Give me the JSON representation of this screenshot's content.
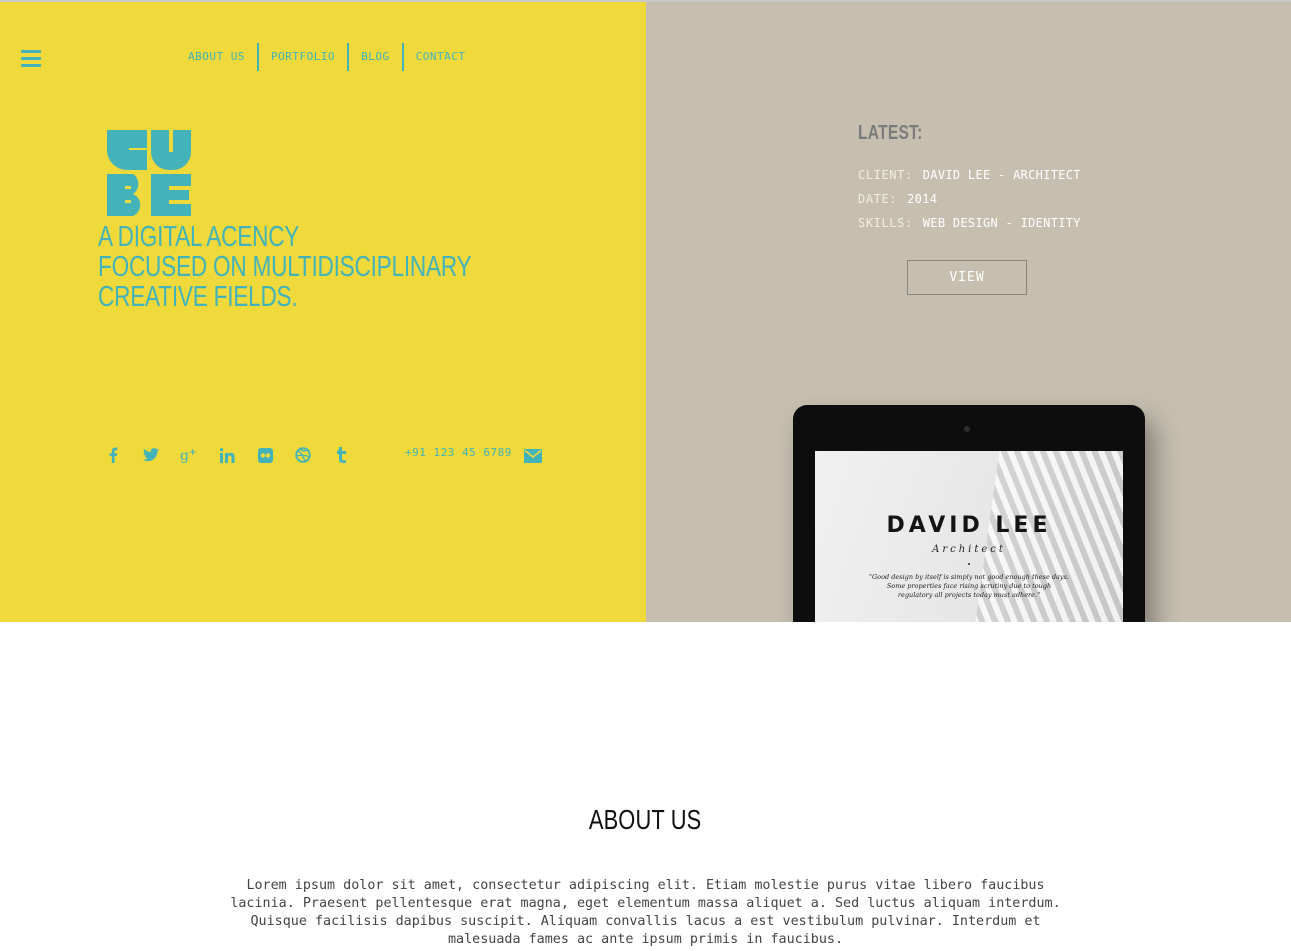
{
  "nav": {
    "items": [
      {
        "label": "ABOUT US"
      },
      {
        "label": "PORTFOLIO"
      },
      {
        "label": "BLOG"
      },
      {
        "label": "CONTACT"
      }
    ]
  },
  "hero": {
    "logo_text": "CUBE",
    "tagline_lines": [
      "A DIGITAL ACENCY",
      "FOCUSED ON MULTIDISCIPLINARY",
      "CREATIVE FIELDS."
    ],
    "social_icons": [
      "facebook-icon",
      "twitter-icon",
      "google-plus-icon",
      "linkedin-icon",
      "flickr-icon",
      "dribbble-icon",
      "tumblr-icon"
    ],
    "phone": "+91 123 45 6789"
  },
  "latest": {
    "title": "LATEST:",
    "client_label": "CLIENT:",
    "client_value": "DAVID LEE - ARCHITECT",
    "date_label": "DATE:",
    "date_value": "2014",
    "skills_label": "SKILLS:",
    "skills_value": "WEB DESIGN - IDENTITY",
    "view_label": "VIEW",
    "tablet": {
      "name": "DAVID LEE",
      "role": "Architect",
      "quote": "\"Good design by itself is simply not good enough these days. Some properties face rising scrutiny due to tough regulatory all projects today must adhere.\""
    }
  },
  "about": {
    "title": "ABOUT US",
    "text": "Lorem ipsum dolor sit amet, consectetur adipiscing elit. Etiam molestie purus vitae libero faucibus lacinia. Praesent pellentesque erat magna, eget elementum massa aliquet a. Sed luctus aliquam interdum. Quisque facilisis dapibus suscipit. Aliquam convallis lacus a est vestibulum pulvinar. Interdum et malesuada fames ac ante ipsum primis in faucibus."
  },
  "colors": {
    "yellow": "#efd93b",
    "teal": "#43b3b9",
    "beige": "#c6bfb0"
  }
}
